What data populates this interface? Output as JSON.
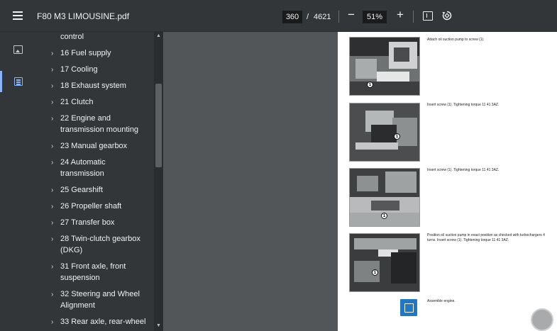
{
  "toolbar": {
    "title": "F80 M3 LIMOUSINE.pdf",
    "current_page": "360",
    "page_separator": "/",
    "total_pages": "4621",
    "zoom_minus": "−",
    "zoom": "51%",
    "zoom_plus": "+"
  },
  "outline": {
    "items": [
      {
        "label": "control",
        "chevron": ""
      },
      {
        "label": "16 Fuel supply",
        "chevron": "›"
      },
      {
        "label": "17 Cooling",
        "chevron": "›"
      },
      {
        "label": "18 Exhaust system",
        "chevron": "›"
      },
      {
        "label": "21 Clutch",
        "chevron": "›"
      },
      {
        "label": "22 Engine and transmission mounting",
        "chevron": "›"
      },
      {
        "label": "23 Manual gearbox",
        "chevron": "›"
      },
      {
        "label": "24 Automatic transmission",
        "chevron": "›"
      },
      {
        "label": "25 Gearshift",
        "chevron": "›"
      },
      {
        "label": "26 Propeller shaft",
        "chevron": "›"
      },
      {
        "label": "27 Transfer box",
        "chevron": "›"
      },
      {
        "label": "28 Twin-clutch gearbox (DKG)",
        "chevron": "›"
      },
      {
        "label": "31 Front axle, front suspension",
        "chevron": "›"
      },
      {
        "label": "32 Steering and Wheel Alignment",
        "chevron": "›"
      },
      {
        "label": "33 Rear axle, rear-wheel",
        "chevron": "›"
      }
    ]
  },
  "scrollbar": {
    "up": "▲",
    "down": "▼"
  },
  "page": {
    "steps": [
      {
        "text": "Attach oil suction pump to screw (1).",
        "callout": "1"
      },
      {
        "text": "Insert screw (1). Tightening torque 11 41 3AZ.",
        "callout": "1"
      },
      {
        "text": "Insert screw (1). Tightening torque 11 41 3AZ.",
        "callout": "1"
      },
      {
        "text": "Position oil suction pump in exact position as checked with turbochargers 4 turns. Insert screw (1). Tightening torque 11 41 3AZ.",
        "callout": "1"
      },
      {
        "text": "Assemble engine."
      }
    ]
  }
}
